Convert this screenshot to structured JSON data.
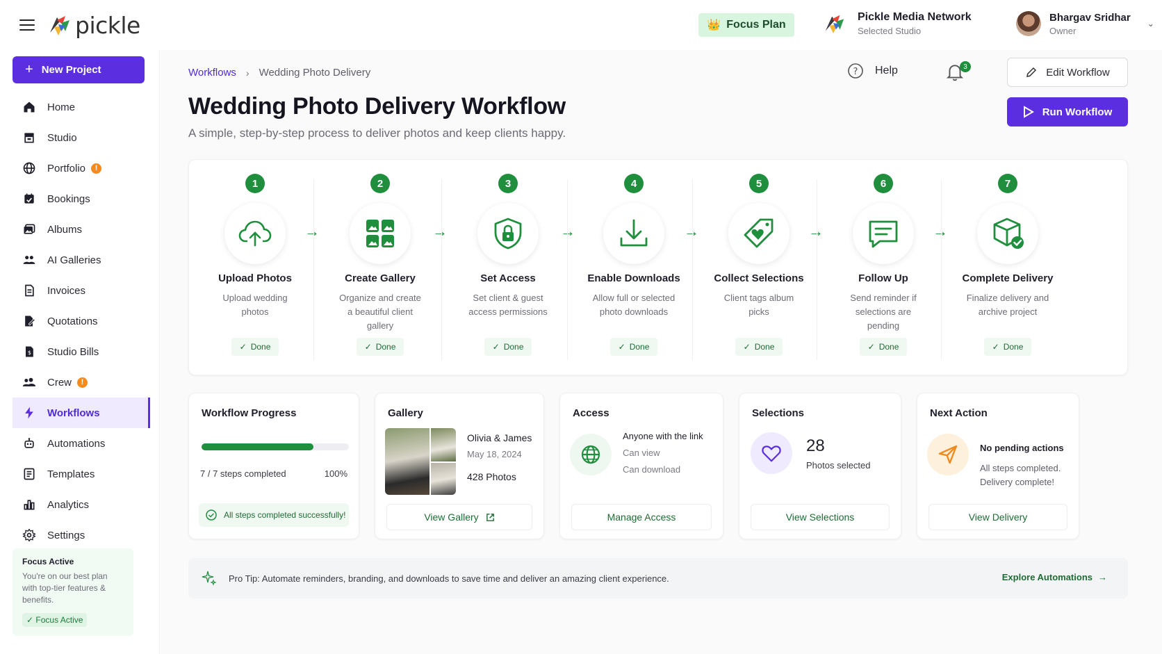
{
  "app": {
    "logo_text": "pickle",
    "plan_label": "Focus Plan",
    "studio_name": "Pickle Media Network",
    "studio_sub": "Selected Studio",
    "user_name": "Bhargav Sridhar",
    "user_role": "Owner"
  },
  "sidebar": {
    "new_project": "New Project",
    "items": [
      {
        "label": "Home",
        "icon": "home-icon"
      },
      {
        "label": "Studio",
        "icon": "store-icon"
      },
      {
        "label": "Portfolio",
        "icon": "globe-icon",
        "badge": "!"
      },
      {
        "label": "Bookings",
        "icon": "calendar-icon"
      },
      {
        "label": "Albums",
        "icon": "images-icon"
      },
      {
        "label": "AI Galleries",
        "icon": "users-icon"
      },
      {
        "label": "Invoices",
        "icon": "file-icon"
      },
      {
        "label": "Quotations",
        "icon": "edit-file-icon"
      },
      {
        "label": "Studio Bills",
        "icon": "bill-icon"
      },
      {
        "label": "Crew",
        "icon": "crew-icon",
        "badge": "!"
      },
      {
        "label": "Workflows",
        "icon": "bolt-icon",
        "active": true
      },
      {
        "label": "Automations",
        "icon": "robot-icon"
      },
      {
        "label": "Templates",
        "icon": "template-icon"
      },
      {
        "label": "Analytics",
        "icon": "bar-chart-icon"
      },
      {
        "label": "Settings",
        "icon": "gear-icon"
      }
    ],
    "focus_card": {
      "title": "Focus Active",
      "text": "You're on our best plan with top-tier features & benefits.",
      "badge": "✓ Focus Active"
    }
  },
  "header": {
    "breadcrumb_root": "Workflows",
    "breadcrumb_current": "Wedding Photo Delivery",
    "help": "Help",
    "notifications": "3",
    "edit_button": "Edit Workflow",
    "run_button": "Run Workflow",
    "title": "Wedding Photo Delivery Workflow",
    "subtitle": "A simple, step-by-step process to deliver photos and keep clients happy."
  },
  "steps": [
    {
      "num": "1",
      "title": "Upload Photos",
      "desc": "Upload wedding photos",
      "status": "Done",
      "icon": "cloud-upload-icon"
    },
    {
      "num": "2",
      "title": "Create Gallery",
      "desc": "Organize and create a beautiful client gallery",
      "status": "Done",
      "icon": "gallery-grid-icon"
    },
    {
      "num": "3",
      "title": "Set Access",
      "desc": "Set client & guest access permissions",
      "status": "Done",
      "icon": "shield-lock-icon"
    },
    {
      "num": "4",
      "title": "Enable Downloads",
      "desc": "Allow full or selected photo downloads",
      "status": "Done",
      "icon": "download-icon"
    },
    {
      "num": "5",
      "title": "Collect Selections",
      "desc": "Client tags album picks",
      "status": "Done",
      "icon": "heart-tag-icon"
    },
    {
      "num": "6",
      "title": "Follow Up",
      "desc": "Send reminder if selections are pending",
      "status": "Done",
      "icon": "message-icon"
    },
    {
      "num": "7",
      "title": "Complete Delivery",
      "desc": "Finalize delivery and archive project",
      "status": "Done",
      "icon": "box-check-icon"
    }
  ],
  "progress": {
    "title": "Workflow Progress",
    "fraction": 0.76,
    "label": "7 / 7 steps completed",
    "pct": "100%",
    "ok": "All steps completed successfully!"
  },
  "gallery": {
    "title": "Gallery",
    "name": "Olivia & James",
    "date": "May 18, 2024",
    "count": "428 Photos",
    "button": "View Gallery"
  },
  "access": {
    "title": "Access",
    "line1": "Anyone with the link",
    "line2": "Can view",
    "line3": "Can download",
    "button": "Manage Access"
  },
  "selections": {
    "title": "Selections",
    "count": "28",
    "label": "Photos selected",
    "button": "View Selections"
  },
  "next_action": {
    "title": "Next Action",
    "line1": "No pending actions",
    "line2": "All steps completed. Delivery complete!",
    "button": "View Delivery"
  },
  "tip": {
    "label": "Pro Tip:",
    "text": "Automate reminders, branding, and downloads to save time and deliver an amazing client experience.",
    "link": "Explore Automations"
  },
  "colors": {
    "primary": "#5b2fe0",
    "success": "#1f8f3e",
    "warning": "#f58b1f"
  }
}
